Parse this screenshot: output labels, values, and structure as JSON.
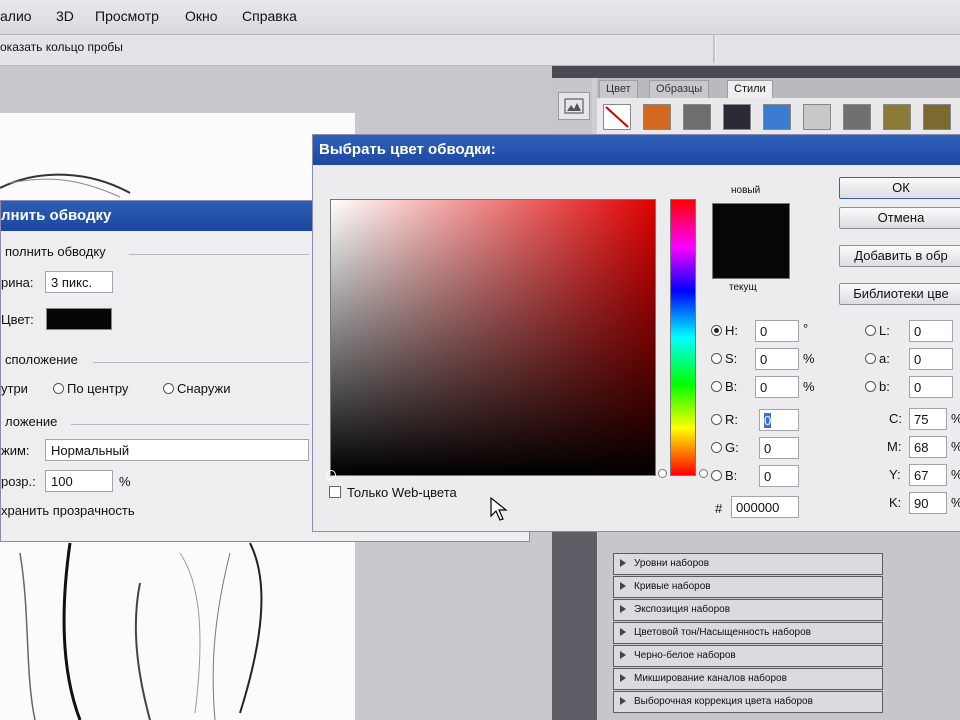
{
  "menu": {
    "items": [
      "алио",
      "3D",
      "Просмотр",
      "Окно",
      "Справка"
    ]
  },
  "options_bar": {
    "label": "оказать кольцо пробы"
  },
  "panel": {
    "tabs": [
      "Цвет",
      "Образцы",
      "Стили"
    ],
    "style_swatches": [
      "#ffffff",
      "#d2691e",
      "#6e6e6e",
      "#2b2b35",
      "#3b7bd0",
      "#c8c8c8",
      "#707070",
      "#8c7a3a",
      "#7a6a30",
      "#9a8a50"
    ],
    "adjustments": [
      "Уровни наборов",
      "Кривые наборов",
      "Экспозиция наборов",
      "Цветовой тон/Насыщенность наборов",
      "Черно-белое наборов",
      "Микширование каналов наборов",
      "Выборочная коррекция цвета наборов"
    ]
  },
  "stroke_dialog": {
    "title": "лнить обводку",
    "group_stroke": "полнить обводку",
    "width_label": "рина:",
    "width_value": "3 пикс.",
    "color_label": "Цвет:",
    "color_value": "#050505",
    "group_location": "сположение",
    "loc_inside": "утри",
    "loc_center": "По центру",
    "loc_outside": "Снаружи",
    "group_blend": "ложение",
    "mode_label": "жим:",
    "mode_value": "Нормальный",
    "opacity_label": "розр.:",
    "opacity_value": "100",
    "opacity_unit": "%",
    "preserve_label": "хранить прозрачность"
  },
  "color_picker": {
    "title": "Выбрать цвет обводки:",
    "new_label": "новый",
    "current_label": "текущ",
    "new_color": "#060606",
    "buttons": {
      "ok": "ОК",
      "cancel": "Отмена",
      "add": "Добавить в обр",
      "libraries": "Библиотеки цве"
    },
    "web_only": "Только Web-цвета",
    "hsb": [
      {
        "label": "H:",
        "value": "0",
        "unit": "°"
      },
      {
        "label": "S:",
        "value": "0",
        "unit": "%"
      },
      {
        "label": "B:",
        "value": "0",
        "unit": "%"
      }
    ],
    "rgb": [
      {
        "label": "R:",
        "value": "0"
      },
      {
        "label": "G:",
        "value": "0"
      },
      {
        "label": "B:",
        "value": "0"
      }
    ],
    "hex_label": "#",
    "hex_value": "000000",
    "lab": [
      {
        "label": "L:",
        "value": "0"
      },
      {
        "label": "a:",
        "value": "0"
      },
      {
        "label": "b:",
        "value": "0"
      }
    ],
    "cmyk": [
      {
        "label": "C:",
        "value": "75",
        "unit": "%"
      },
      {
        "label": "M:",
        "value": "68",
        "unit": "%"
      },
      {
        "label": "Y:",
        "value": "67",
        "unit": "%"
      },
      {
        "label": "K:",
        "value": "90",
        "unit": "%"
      }
    ]
  }
}
